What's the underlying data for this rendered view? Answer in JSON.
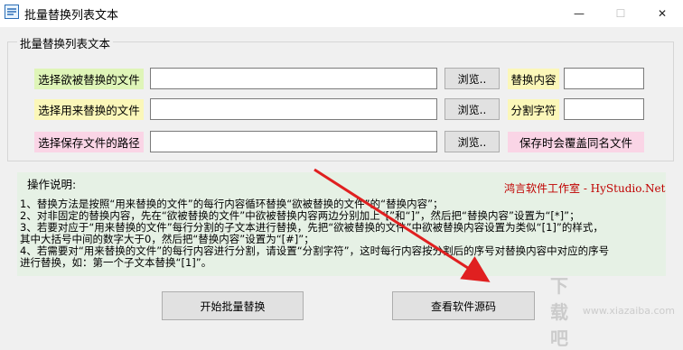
{
  "window": {
    "title": "批量替换列表文本",
    "controls": {
      "minimize": "—",
      "maximize": "☐",
      "close": "✕"
    }
  },
  "group": {
    "title": "批量替换列表文本"
  },
  "rows": [
    {
      "label": "选择欲被替换的文件",
      "value": "",
      "browse": "浏览..",
      "side_label": "替换内容",
      "side_value": ""
    },
    {
      "label": "选择用来替换的文件",
      "value": "",
      "browse": "浏览..",
      "side_label": "分割字符",
      "side_value": ""
    },
    {
      "label": "选择保存文件的路径",
      "value": "",
      "browse": "浏览..",
      "side_label": "保存时会覆盖同名文件"
    }
  ],
  "info": {
    "title": "操作说明:",
    "brand": "鸿言软件工作室 - HyStudio.Net",
    "lines": [
      "1、替换方法是按照“用来替换的文件”的每行内容循环替换“欲被替换的文件”的“替换内容”；",
      "2、对非固定的替换内容，先在“欲被替换的文件”中欲被替换内容两边分别加上“[”和“]”，然后把“替换内容”设置为“[*]”；",
      "3、若要对应于“用来替换的文件”每行分割的子文本进行替换，先把“欲被替换的文件”中欲被替换内容设置为类似“[1]”的样式，",
      "其中大括号中间的数字大于0，然后把“替换内容”设置为“[#]”；",
      "4、若需要对“用来替换的文件”的每行内容进行分割，请设置“分割字符”，这时每行内容按分割后的序号对替换内容中对应的序号",
      "进行替换，如：第一个子文本替换“[1]”。"
    ]
  },
  "buttons": {
    "start": "开始批量替换",
    "source": "查看软件源码"
  },
  "watermark": {
    "text": "下载吧",
    "url": "www.xiazaiba.com"
  },
  "colors": {
    "annotation_arrow": "#e02020",
    "brand_text": "#c00000"
  }
}
